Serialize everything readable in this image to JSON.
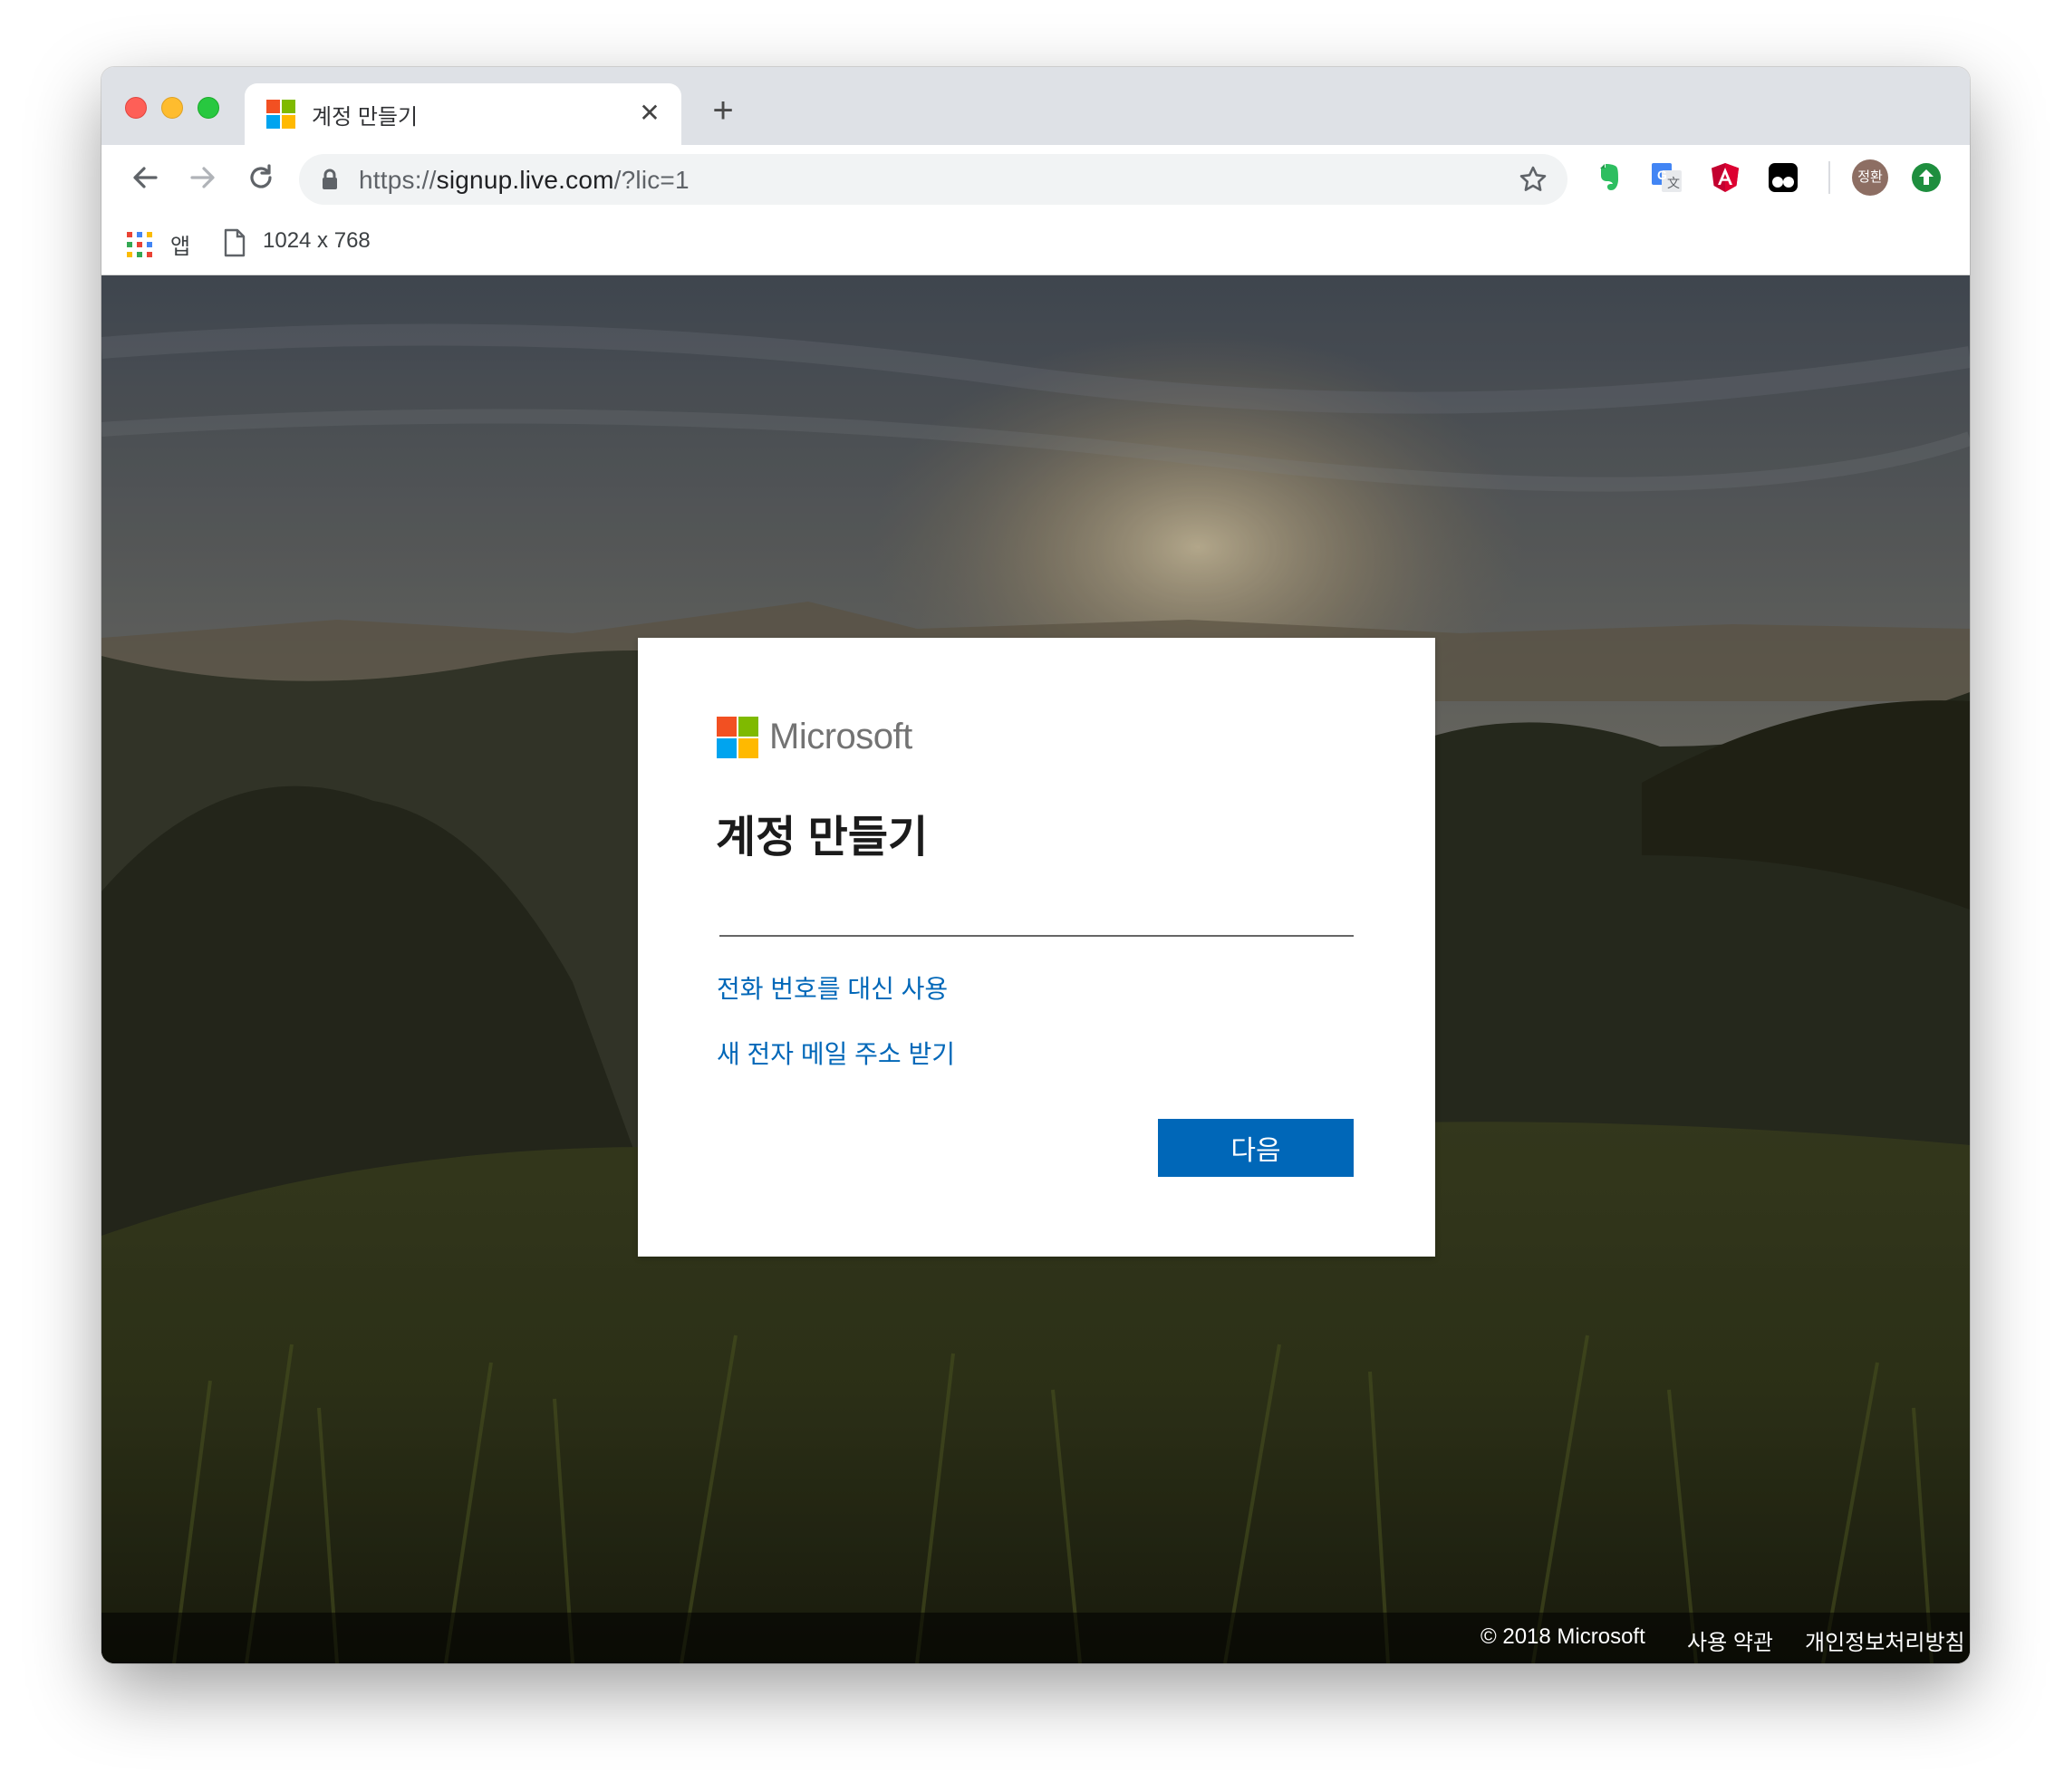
{
  "browser": {
    "tab": {
      "title": "계정 만들기",
      "close": "✕"
    },
    "new_tab": "+",
    "url": {
      "scheme": "https://",
      "host": "signup.live.com",
      "path": "/?lic=1"
    },
    "profile_initials": "정환",
    "bookmarks": [
      {
        "label": "앱",
        "icon": "apps-grid-icon"
      },
      {
        "label": "1024 x 768",
        "icon": "page-icon"
      }
    ],
    "extensions": [
      "evernote-icon",
      "google-translate-icon",
      "angular-icon",
      "tampermonkey-icon"
    ]
  },
  "card": {
    "brand": "Microsoft",
    "title": "계정 만들기",
    "email_input_value": "",
    "links": [
      "전화 번호를 대신 사용",
      "새 전자 메일 주소 받기"
    ],
    "next_label": "다음"
  },
  "footer": {
    "copyright": "© 2018 Microsoft",
    "terms": "사용 약관",
    "privacy": "개인정보처리방침"
  },
  "colors": {
    "ms_red": "#f25022",
    "ms_green": "#7fba00",
    "ms_blue": "#00a4ef",
    "ms_yellow": "#ffb900",
    "accent": "#0067b8"
  }
}
